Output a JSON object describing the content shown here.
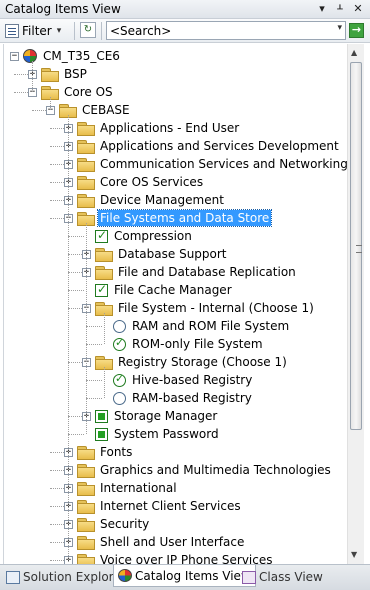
{
  "window": {
    "title": "Catalog Items View",
    "dropdown_glyph": "▾",
    "pin_glyph": "ᚆ",
    "close_glyph": "✕"
  },
  "toolbar": {
    "filter_label": "Filter",
    "filter_dropdown_glyph": "▾",
    "refresh_glyph": "↻",
    "search_placeholder": "<Search>",
    "search_dropdown_glyph": "▾",
    "go_glyph": "→"
  },
  "tree": [
    {
      "label": "CM_T35_CE6",
      "level": 0,
      "icon": "root",
      "expander": "minus"
    },
    {
      "label": "BSP",
      "level": 1,
      "icon": "folder",
      "expander": "plus"
    },
    {
      "label": "Core OS",
      "level": 1,
      "icon": "folder",
      "expander": "minus"
    },
    {
      "label": "CEBASE",
      "level": 2,
      "icon": "folder",
      "expander": "minus"
    },
    {
      "label": "Applications - End User",
      "level": 3,
      "icon": "folder",
      "expander": "plus"
    },
    {
      "label": "Applications and Services Development",
      "level": 3,
      "icon": "folder",
      "expander": "plus"
    },
    {
      "label": "Communication Services and Networking",
      "level": 3,
      "icon": "folder",
      "expander": "plus"
    },
    {
      "label": "Core OS Services",
      "level": 3,
      "icon": "folder",
      "expander": "plus"
    },
    {
      "label": "Device Management",
      "level": 3,
      "icon": "folder",
      "expander": "plus"
    },
    {
      "label": "File Systems and Data Store",
      "level": 3,
      "icon": "folder",
      "expander": "minus",
      "selected": true
    },
    {
      "label": "Compression",
      "level": 4,
      "icon": "check",
      "expander": "none"
    },
    {
      "label": "Database Support",
      "level": 4,
      "icon": "folder",
      "expander": "plus"
    },
    {
      "label": "File and Database Replication",
      "level": 4,
      "icon": "folder",
      "expander": "plus"
    },
    {
      "label": "File Cache Manager",
      "level": 4,
      "icon": "check",
      "expander": "none"
    },
    {
      "label": "File System - Internal (Choose 1)",
      "level": 4,
      "icon": "folder",
      "expander": "minus"
    },
    {
      "label": "RAM and ROM File System",
      "level": 5,
      "icon": "radio-off",
      "expander": "none"
    },
    {
      "label": "ROM-only File System",
      "level": 5,
      "icon": "radio-on",
      "expander": "none"
    },
    {
      "label": "Registry Storage (Choose 1)",
      "level": 4,
      "icon": "folder",
      "expander": "minus"
    },
    {
      "label": "Hive-based Registry",
      "level": 5,
      "icon": "radio-on",
      "expander": "none"
    },
    {
      "label": "RAM-based Registry",
      "level": 5,
      "icon": "radio-off",
      "expander": "none"
    },
    {
      "label": "Storage Manager",
      "level": 4,
      "icon": "square",
      "expander": "plus"
    },
    {
      "label": "System Password",
      "level": 4,
      "icon": "square",
      "expander": "none"
    },
    {
      "label": "Fonts",
      "level": 3,
      "icon": "folder",
      "expander": "plus"
    },
    {
      "label": "Graphics and Multimedia Technologies",
      "level": 3,
      "icon": "folder",
      "expander": "plus"
    },
    {
      "label": "International",
      "level": 3,
      "icon": "folder",
      "expander": "plus"
    },
    {
      "label": "Internet Client Services",
      "level": 3,
      "icon": "folder",
      "expander": "plus"
    },
    {
      "label": "Security",
      "level": 3,
      "icon": "folder",
      "expander": "plus"
    },
    {
      "label": "Shell and User Interface",
      "level": 3,
      "icon": "folder",
      "expander": "plus"
    },
    {
      "label": "Voice over IP Phone Services",
      "level": 3,
      "icon": "folder",
      "expander": "plus"
    }
  ],
  "scrollbar": {
    "up_glyph": "▲",
    "down_glyph": "▼"
  },
  "tabs": [
    {
      "label": "Solution Explorer",
      "active": false,
      "icon": "solution-explorer-icon"
    },
    {
      "label": "Catalog Items View",
      "active": true,
      "icon": "catalog-icon"
    },
    {
      "label": "Class View",
      "active": false,
      "icon": "class-view-icon"
    }
  ],
  "colors": {
    "selection": "#3399ff",
    "check_green": "#1f8a1f",
    "folder": "#e8bd4b"
  }
}
